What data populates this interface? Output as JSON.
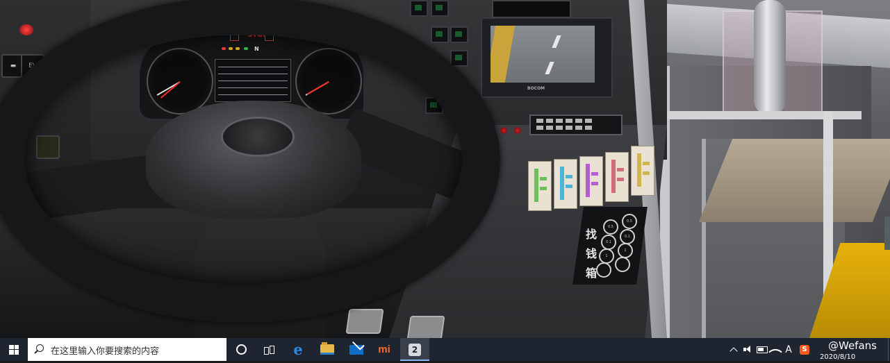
{
  "scene": {
    "dashboard": {
      "cluster": {
        "stop_label": "STOP",
        "gear_label": "N"
      },
      "left_switch_label": "EV",
      "monitor_brand": "BOCOM",
      "change_box": {
        "chars": [
          "找",
          "钱",
          "箱"
        ],
        "coin_labels": [
          "0.5",
          "0.5",
          "0.1",
          "0.1",
          "1",
          "1",
          "",
          ""
        ]
      },
      "ticket_colors": [
        "#6dbf5a",
        "#48b6d6",
        "#b65bd0",
        "#d36b7a",
        "#cfb54a"
      ]
    }
  },
  "taskbar": {
    "search_placeholder": "在这里输入你要搜索的内容",
    "apps": [
      {
        "name": "edge",
        "glyph": "e"
      },
      {
        "name": "file-explorer",
        "glyph": ""
      },
      {
        "name": "mail",
        "glyph": ""
      },
      {
        "name": "xiaomi",
        "glyph": "mi"
      },
      {
        "name": "bus-simulator",
        "glyph": "2"
      }
    ],
    "tray": {
      "ime_label": "A",
      "sogou_label": "S"
    },
    "clock_date": "2020/8/10",
    "watermark": "@Wefans"
  }
}
